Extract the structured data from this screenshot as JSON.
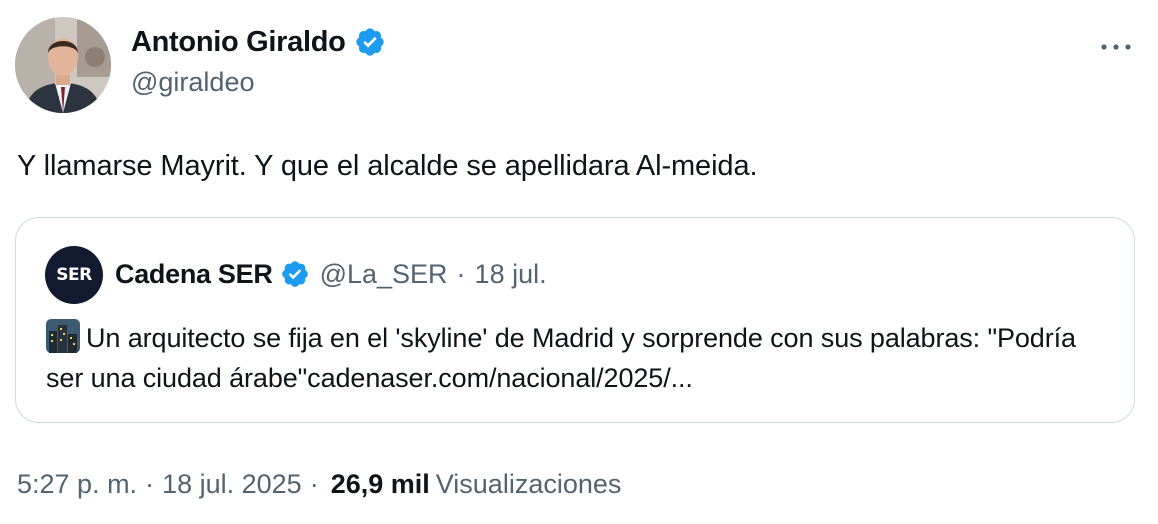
{
  "tweet": {
    "author": {
      "name": "Antonio Giraldo",
      "handle": "@giraldeo",
      "verified": true
    },
    "text": "Y llamarse Mayrit. Y que el alcalde se apellidara Al-meida.",
    "quote": {
      "author_name": "Cadena SER",
      "avatar_text": "SER",
      "handle": "@La_SER",
      "separator": "·",
      "date": "18 jul.",
      "emoji": "cityscape-icon",
      "text": "Un arquitecto se fija en el 'skyline' de Madrid y sorprende con sus palabras: \"Podría ser una ciudad árabe\"",
      "link": "cadenaser.com/nacional/2025/..."
    },
    "meta": {
      "time": "5:27 p. m.",
      "separator": "·",
      "date": "18 jul. 2025",
      "separator2": "·",
      "views_count": "26,9 mil",
      "views_label": "Visualizaciones"
    }
  },
  "colors": {
    "verified": "#1d9bf0",
    "secondary_text": "#536471",
    "border": "#cfd9de",
    "primary_text": "#0f1419"
  }
}
